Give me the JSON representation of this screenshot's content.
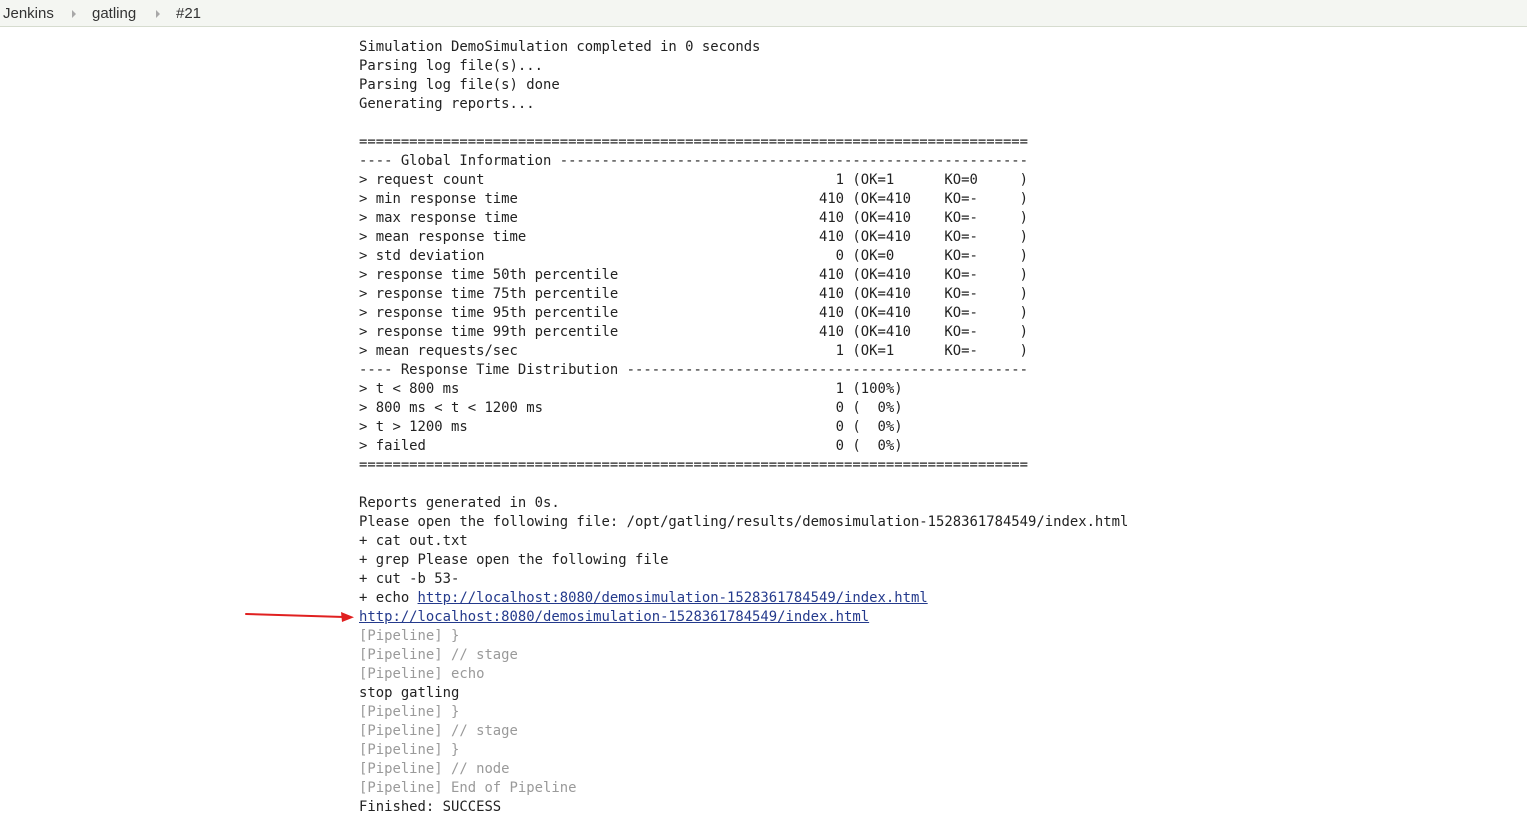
{
  "breadcrumb": [
    {
      "label": "Jenkins"
    },
    {
      "label": "gatling"
    },
    {
      "label": "#21"
    }
  ],
  "console": {
    "lines": [
      {
        "text": "Simulation DemoSimulation completed in 0 seconds",
        "kind": "output"
      },
      {
        "text": "Parsing log file(s)...",
        "kind": "output"
      },
      {
        "text": "Parsing log file(s) done",
        "kind": "output"
      },
      {
        "text": "Generating reports...",
        "kind": "output"
      },
      {
        "text": "",
        "kind": "output"
      },
      {
        "text": "================================================================================",
        "kind": "output"
      },
      {
        "text": "---- Global Information --------------------------------------------------------",
        "kind": "output"
      },
      {
        "text": "> request count                                          1 (OK=1      KO=0     )",
        "kind": "output"
      },
      {
        "text": "> min response time                                    410 (OK=410    KO=-     )",
        "kind": "output"
      },
      {
        "text": "> max response time                                    410 (OK=410    KO=-     )",
        "kind": "output"
      },
      {
        "text": "> mean response time                                   410 (OK=410    KO=-     )",
        "kind": "output"
      },
      {
        "text": "> std deviation                                          0 (OK=0      KO=-     )",
        "kind": "output"
      },
      {
        "text": "> response time 50th percentile                        410 (OK=410    KO=-     )",
        "kind": "output"
      },
      {
        "text": "> response time 75th percentile                        410 (OK=410    KO=-     )",
        "kind": "output"
      },
      {
        "text": "> response time 95th percentile                        410 (OK=410    KO=-     )",
        "kind": "output"
      },
      {
        "text": "> response time 99th percentile                        410 (OK=410    KO=-     )",
        "kind": "output"
      },
      {
        "text": "> mean requests/sec                                      1 (OK=1      KO=-     )",
        "kind": "output"
      },
      {
        "text": "---- Response Time Distribution ------------------------------------------------",
        "kind": "output"
      },
      {
        "text": "> t < 800 ms                                             1 (100%)",
        "kind": "output"
      },
      {
        "text": "> 800 ms < t < 1200 ms                                   0 (  0%)",
        "kind": "output"
      },
      {
        "text": "> t > 1200 ms                                            0 (  0%)",
        "kind": "output"
      },
      {
        "text": "> failed                                                 0 (  0%)",
        "kind": "output"
      },
      {
        "text": "================================================================================",
        "kind": "output"
      },
      {
        "text": "",
        "kind": "output"
      },
      {
        "text": "Reports generated in 0s.",
        "kind": "output"
      },
      {
        "text": "Please open the following file: /opt/gatling/results/demosimulation-1528361784549/index.html",
        "kind": "output"
      },
      {
        "text": "+ cat out.txt",
        "kind": "output"
      },
      {
        "text": "+ grep Please open the following file",
        "kind": "output"
      },
      {
        "text": "+ cut -b 53-",
        "kind": "output"
      },
      {
        "text": "+ echo ",
        "kind": "output",
        "link": "http://localhost:8080/demosimulation-1528361784549/index.html"
      },
      {
        "text": "",
        "kind": "output",
        "link": "http://localhost:8080/demosimulation-1528361784549/index.html"
      },
      {
        "text": "[Pipeline] }",
        "kind": "pipeline"
      },
      {
        "text": "[Pipeline] // stage",
        "kind": "pipeline"
      },
      {
        "text": "[Pipeline] echo",
        "kind": "pipeline"
      },
      {
        "text": "stop gatling",
        "kind": "output"
      },
      {
        "text": "[Pipeline] }",
        "kind": "pipeline"
      },
      {
        "text": "[Pipeline] // stage",
        "kind": "pipeline"
      },
      {
        "text": "[Pipeline] }",
        "kind": "pipeline"
      },
      {
        "text": "[Pipeline] // node",
        "kind": "pipeline"
      },
      {
        "text": "[Pipeline] End of Pipeline",
        "kind": "pipeline"
      },
      {
        "text": "Finished: SUCCESS",
        "kind": "output"
      }
    ]
  },
  "colors": {
    "link": "#243a8c",
    "pipeline_text": "#9a9a9a",
    "arrow": "#e02020",
    "breadcrumb_bg": "#f4f6f2"
  },
  "icons": {
    "breadcrumb_separator": "triangle-right-icon",
    "annotation": "red-arrow-icon"
  }
}
